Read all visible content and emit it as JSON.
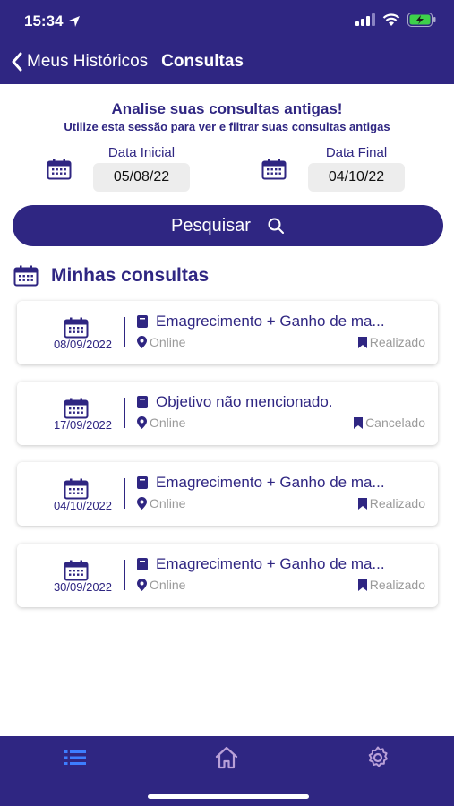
{
  "status_bar": {
    "time": "15:34"
  },
  "header": {
    "back_label": "Meus Históricos",
    "title": "Consultas"
  },
  "intro": {
    "title": "Analise suas consultas antigas!",
    "subtitle": "Utilize esta sessão para ver e filtrar suas consultas antigas"
  },
  "filters": {
    "start_label": "Data Inicial",
    "start_value": "05/08/22",
    "end_label": "Data Final",
    "end_value": "04/10/22"
  },
  "search": {
    "label": "Pesquisar"
  },
  "section": {
    "title": "Minhas consultas"
  },
  "consultations": [
    {
      "date": "08/09/2022",
      "objective": "Emagrecimento + Ganho de ma...",
      "location": "Online",
      "status": "Realizado"
    },
    {
      "date": "17/09/2022",
      "objective": "Objetivo não mencionado.",
      "location": "Online",
      "status": "Cancelado"
    },
    {
      "date": "04/10/2022",
      "objective": "Emagrecimento + Ganho de ma...",
      "location": "Online",
      "status": "Realizado"
    },
    {
      "date": "30/09/2022",
      "objective": "Emagrecimento + Ganho de ma...",
      "location": "Online",
      "status": "Realizado"
    }
  ],
  "tabbar": {
    "items": [
      "list-icon",
      "home-icon",
      "gear-icon"
    ],
    "active": "list-icon"
  },
  "colors": {
    "primary": "#2f2682",
    "active_tab": "#3d7dff",
    "inactive_tab": "#b9a0d8",
    "muted": "#9a9a9a"
  }
}
